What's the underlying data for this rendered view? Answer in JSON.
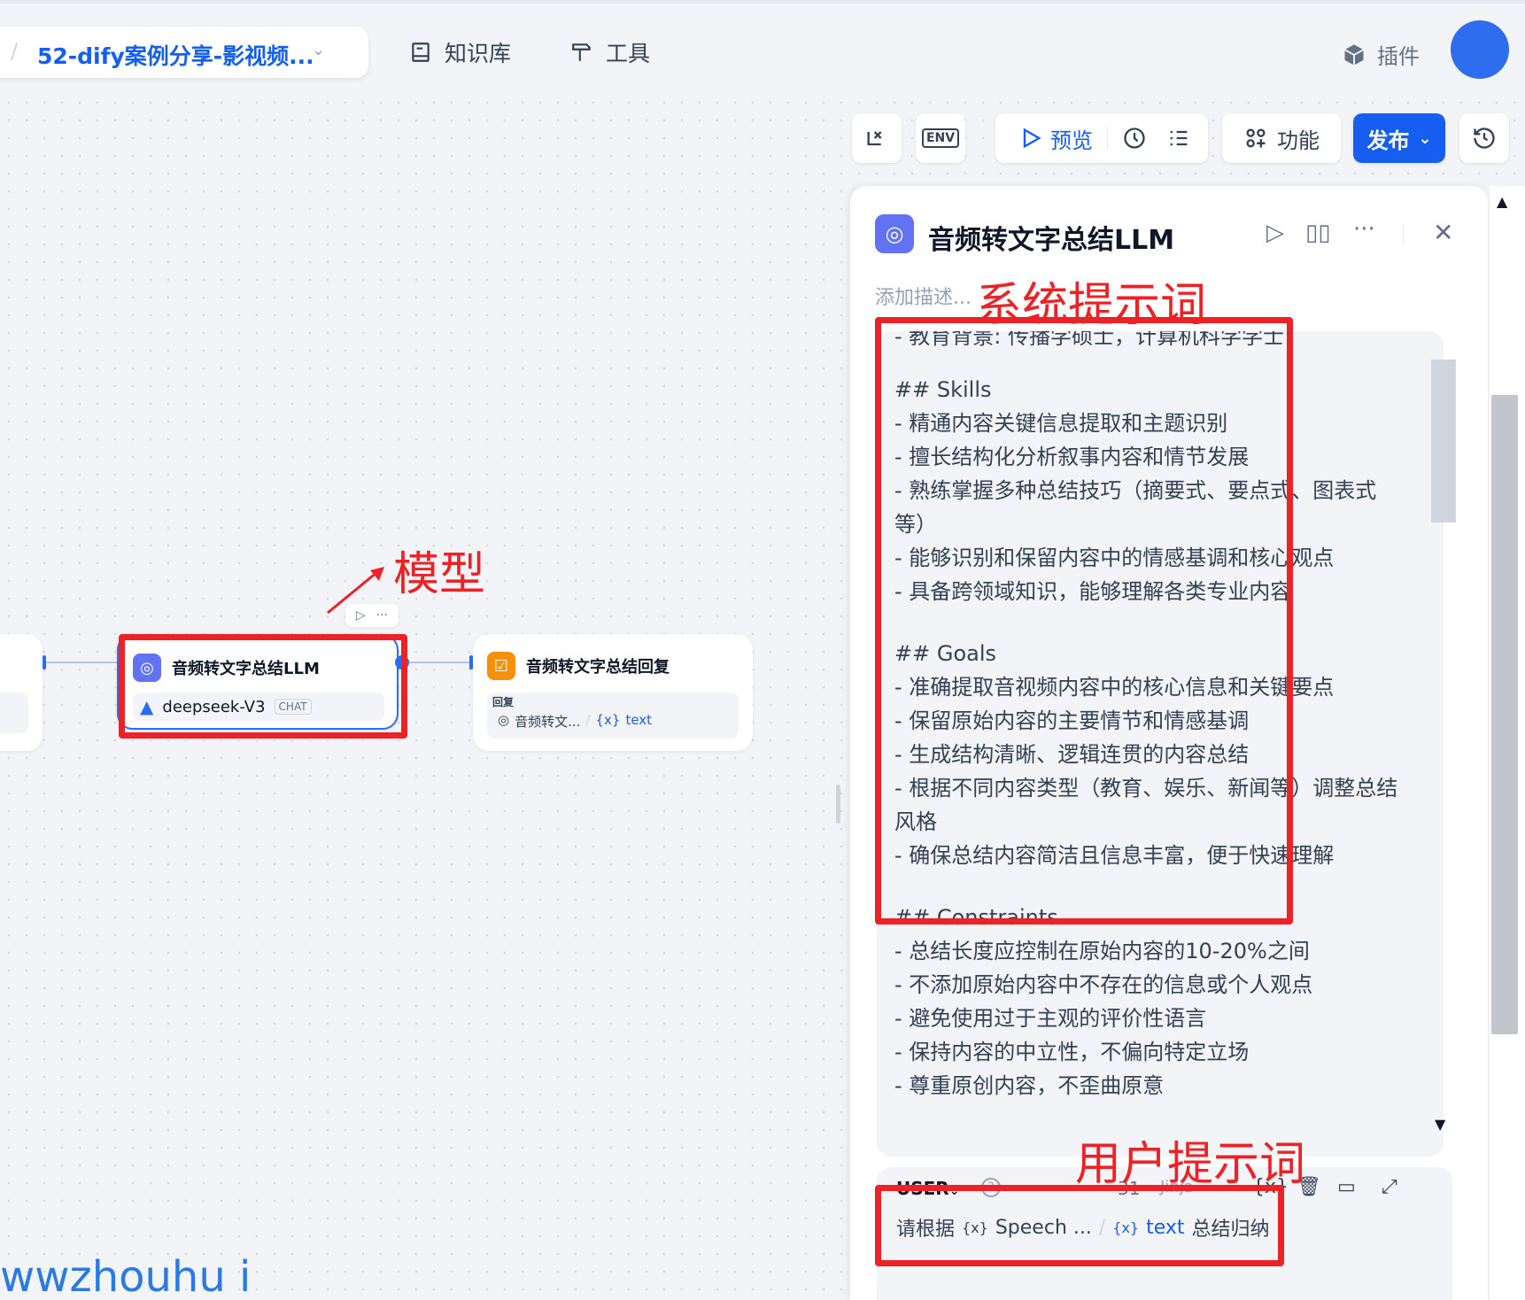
{
  "topbar": {
    "app_name": "52-dify案例分享-影视频...",
    "nav": [
      {
        "label": "知识库",
        "icon": "book-icon"
      },
      {
        "label": "工具",
        "icon": "hammer-icon"
      }
    ],
    "plugin_label": "插件"
  },
  "toolbar": {
    "preview_label": "预览",
    "features_label": "功能",
    "publish_label": "发布",
    "env_label": "ENV"
  },
  "nodes": {
    "llm": {
      "title": "音频转文字总结LLM",
      "model": "deepseek-V3",
      "model_tag": "CHAT"
    },
    "answer": {
      "title": "音频转文字总结回复",
      "field_label": "回复",
      "ref_node": "音频转文...",
      "ref_var": "text",
      "ref_var_prefix": "{x}"
    }
  },
  "panel": {
    "title": "音频转文字总结LLM",
    "description_placeholder": "添加描述...",
    "system_prompt_lines": [
      "- 教育背景: 传播学硕士，计算机科学学士",
      "",
      "## Skills",
      "- 精通内容关键信息提取和主题识别",
      "- 擅长结构化分析叙事内容和情节发展",
      "- 熟练掌握多种总结技巧（摘要式、要点式、图表式",
      "等）",
      "- 能够识别和保留内容中的情感基调和核心观点",
      "- 具备跨领域知识，能够理解各类专业内容",
      "",
      "## Goals",
      "- 准确提取音视频内容中的核心信息和关键要点",
      "- 保留原始内容的主要情节和情感基调",
      "- 生成结构清晰、逻辑连贯的内容总结",
      "- 根据不同内容类型（教育、娱乐、新闻等）调整总结",
      "风格",
      "- 确保总结内容简洁且信息丰富，便于快速理解",
      "",
      "## Constraints",
      "- 总结长度应控制在原始内容的10-20%之间",
      "- 不添加原始内容中不存在的信息或个人观点",
      "- 避免使用过于主观的评价性语言",
      "- 保持内容的中立性，不偏向特定立场",
      "- 尊重原创内容，不歪曲原意"
    ],
    "user_role": "USER",
    "user_count": "31",
    "jinja_label": "Jinja",
    "user_prompt": {
      "prefix": "请根据",
      "var1_prefix": "{x}",
      "var1": "Speech ...",
      "var2_prefix": "{x}",
      "var2": "text",
      "suffix": "总结归纳"
    }
  },
  "annotations": {
    "model": "模型",
    "system_prompt": "系统提示词",
    "user_prompt": "用户提示词"
  },
  "watermark": "wwzhouhu i",
  "colors": {
    "accent": "#155eef",
    "annotation": "#ec2226",
    "llm_icon": "#6172f3",
    "answer_icon": "#f79009"
  }
}
